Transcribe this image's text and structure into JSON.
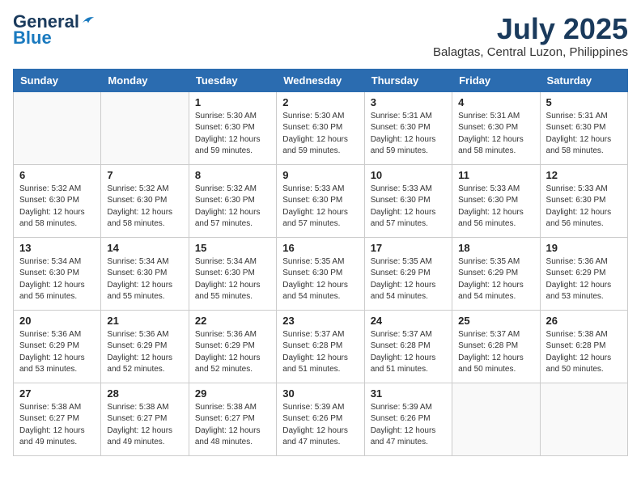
{
  "header": {
    "logo_general": "General",
    "logo_blue": "Blue",
    "month_year": "July 2025",
    "location": "Balagtas, Central Luzon, Philippines"
  },
  "weekdays": [
    "Sunday",
    "Monday",
    "Tuesday",
    "Wednesday",
    "Thursday",
    "Friday",
    "Saturday"
  ],
  "weeks": [
    [
      {
        "day": "",
        "info": ""
      },
      {
        "day": "",
        "info": ""
      },
      {
        "day": "1",
        "info": "Sunrise: 5:30 AM\nSunset: 6:30 PM\nDaylight: 12 hours\nand 59 minutes."
      },
      {
        "day": "2",
        "info": "Sunrise: 5:30 AM\nSunset: 6:30 PM\nDaylight: 12 hours\nand 59 minutes."
      },
      {
        "day": "3",
        "info": "Sunrise: 5:31 AM\nSunset: 6:30 PM\nDaylight: 12 hours\nand 59 minutes."
      },
      {
        "day": "4",
        "info": "Sunrise: 5:31 AM\nSunset: 6:30 PM\nDaylight: 12 hours\nand 58 minutes."
      },
      {
        "day": "5",
        "info": "Sunrise: 5:31 AM\nSunset: 6:30 PM\nDaylight: 12 hours\nand 58 minutes."
      }
    ],
    [
      {
        "day": "6",
        "info": "Sunrise: 5:32 AM\nSunset: 6:30 PM\nDaylight: 12 hours\nand 58 minutes."
      },
      {
        "day": "7",
        "info": "Sunrise: 5:32 AM\nSunset: 6:30 PM\nDaylight: 12 hours\nand 58 minutes."
      },
      {
        "day": "8",
        "info": "Sunrise: 5:32 AM\nSunset: 6:30 PM\nDaylight: 12 hours\nand 57 minutes."
      },
      {
        "day": "9",
        "info": "Sunrise: 5:33 AM\nSunset: 6:30 PM\nDaylight: 12 hours\nand 57 minutes."
      },
      {
        "day": "10",
        "info": "Sunrise: 5:33 AM\nSunset: 6:30 PM\nDaylight: 12 hours\nand 57 minutes."
      },
      {
        "day": "11",
        "info": "Sunrise: 5:33 AM\nSunset: 6:30 PM\nDaylight: 12 hours\nand 56 minutes."
      },
      {
        "day": "12",
        "info": "Sunrise: 5:33 AM\nSunset: 6:30 PM\nDaylight: 12 hours\nand 56 minutes."
      }
    ],
    [
      {
        "day": "13",
        "info": "Sunrise: 5:34 AM\nSunset: 6:30 PM\nDaylight: 12 hours\nand 56 minutes."
      },
      {
        "day": "14",
        "info": "Sunrise: 5:34 AM\nSunset: 6:30 PM\nDaylight: 12 hours\nand 55 minutes."
      },
      {
        "day": "15",
        "info": "Sunrise: 5:34 AM\nSunset: 6:30 PM\nDaylight: 12 hours\nand 55 minutes."
      },
      {
        "day": "16",
        "info": "Sunrise: 5:35 AM\nSunset: 6:30 PM\nDaylight: 12 hours\nand 54 minutes."
      },
      {
        "day": "17",
        "info": "Sunrise: 5:35 AM\nSunset: 6:29 PM\nDaylight: 12 hours\nand 54 minutes."
      },
      {
        "day": "18",
        "info": "Sunrise: 5:35 AM\nSunset: 6:29 PM\nDaylight: 12 hours\nand 54 minutes."
      },
      {
        "day": "19",
        "info": "Sunrise: 5:36 AM\nSunset: 6:29 PM\nDaylight: 12 hours\nand 53 minutes."
      }
    ],
    [
      {
        "day": "20",
        "info": "Sunrise: 5:36 AM\nSunset: 6:29 PM\nDaylight: 12 hours\nand 53 minutes."
      },
      {
        "day": "21",
        "info": "Sunrise: 5:36 AM\nSunset: 6:29 PM\nDaylight: 12 hours\nand 52 minutes."
      },
      {
        "day": "22",
        "info": "Sunrise: 5:36 AM\nSunset: 6:29 PM\nDaylight: 12 hours\nand 52 minutes."
      },
      {
        "day": "23",
        "info": "Sunrise: 5:37 AM\nSunset: 6:28 PM\nDaylight: 12 hours\nand 51 minutes."
      },
      {
        "day": "24",
        "info": "Sunrise: 5:37 AM\nSunset: 6:28 PM\nDaylight: 12 hours\nand 51 minutes."
      },
      {
        "day": "25",
        "info": "Sunrise: 5:37 AM\nSunset: 6:28 PM\nDaylight: 12 hours\nand 50 minutes."
      },
      {
        "day": "26",
        "info": "Sunrise: 5:38 AM\nSunset: 6:28 PM\nDaylight: 12 hours\nand 50 minutes."
      }
    ],
    [
      {
        "day": "27",
        "info": "Sunrise: 5:38 AM\nSunset: 6:27 PM\nDaylight: 12 hours\nand 49 minutes."
      },
      {
        "day": "28",
        "info": "Sunrise: 5:38 AM\nSunset: 6:27 PM\nDaylight: 12 hours\nand 49 minutes."
      },
      {
        "day": "29",
        "info": "Sunrise: 5:38 AM\nSunset: 6:27 PM\nDaylight: 12 hours\nand 48 minutes."
      },
      {
        "day": "30",
        "info": "Sunrise: 5:39 AM\nSunset: 6:26 PM\nDaylight: 12 hours\nand 47 minutes."
      },
      {
        "day": "31",
        "info": "Sunrise: 5:39 AM\nSunset: 6:26 PM\nDaylight: 12 hours\nand 47 minutes."
      },
      {
        "day": "",
        "info": ""
      },
      {
        "day": "",
        "info": ""
      }
    ]
  ]
}
